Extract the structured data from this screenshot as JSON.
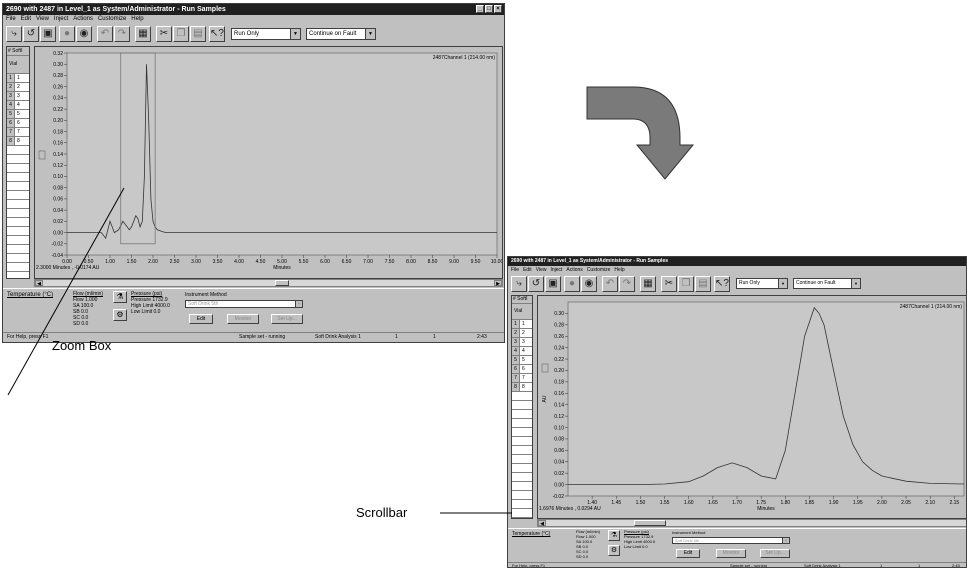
{
  "window": {
    "title": "2690 with 2487 in Level_1 as System/Administrator - Run Samples",
    "menu": [
      "File",
      "Edit",
      "View",
      "Inject",
      "Actions",
      "Customize",
      "Help"
    ],
    "run_mode": "Run Only",
    "fault_mode": "Continue on Fault",
    "grid_header": "Vial",
    "grid_corner": "#",
    "grid_col1": "SoftI",
    "grid_rows": [
      "1",
      "2",
      "3",
      "4",
      "5",
      "6",
      "7",
      "8"
    ],
    "grid_vials": [
      "1",
      "2",
      "3",
      "4",
      "5",
      "6",
      "7",
      "8"
    ],
    "temperature_label": "Temperature (°C)",
    "flow": {
      "label": "Flow (ml/min)",
      "flow": "Flow  1.000",
      "sa": "SA  100.0",
      "sb": "SB  0.0",
      "sc": "SC  0.0",
      "sd": "SD  0.0"
    },
    "pressure": {
      "label": "Pressure (psi)",
      "pressure": "Pressure  1732.9",
      "high": "High Limit 4000.0",
      "low": "Low Limit  0.0"
    },
    "method": {
      "label": "Instrument Method",
      "value": "Soft Drink 5th",
      "edit": "Edit",
      "view": "Monitor",
      "setup": "Set Up..."
    },
    "status": {
      "help": "For Help, press F1",
      "run": "Sample set - running",
      "method": "Soft Drink Analysis 1",
      "page": "1",
      "vial": "1",
      "time": "2:43"
    }
  },
  "plot1": {
    "channel": "2487Channel 1 (214.00 nm)",
    "xlabel": "Minutes",
    "ylabel": "AU",
    "cursor": "2.3000 Minutes , -0.0174 AU"
  },
  "plot2": {
    "channel": "2487Channel 1 (214.00 nm)",
    "xlabel": "Minutes",
    "ylabel": "AU",
    "cursor": "1.6976 Minutes , 0.0294 AU"
  },
  "annotations": {
    "zoom": "Zoom Box",
    "scrollbar": "Scrollbar"
  },
  "chart_data": [
    {
      "type": "line",
      "title": "2487Channel 1 (214.00 nm)",
      "xlabel": "Minutes",
      "ylabel": "AU",
      "xlim": [
        0,
        10
      ],
      "ylim": [
        -0.04,
        0.32
      ],
      "x_ticks": [
        "0.00",
        "0.50",
        "1.00",
        "1.50",
        "2.00",
        "2.50",
        "3.00",
        "3.50",
        "4.00",
        "4.50",
        "5.00",
        "5.50",
        "6.00",
        "6.50",
        "7.00",
        "7.50",
        "8.00",
        "8.50",
        "9.00",
        "9.50",
        "10.00"
      ],
      "y_ticks": [
        "-0.04",
        "-0.02",
        "0.00",
        "0.02",
        "0.04",
        "0.06",
        "0.08",
        "0.10",
        "0.12",
        "0.14",
        "0.16",
        "0.18",
        "0.20",
        "0.22",
        "0.24",
        "0.26",
        "0.28",
        "0.30",
        "0.32"
      ],
      "series": [
        {
          "x": [
            0,
            0.5,
            0.8,
            0.9,
            1.0,
            1.05,
            1.1,
            1.2,
            1.3,
            1.4,
            1.45,
            1.5,
            1.55,
            1.6,
            1.65,
            1.7,
            1.75,
            1.8,
            1.85,
            1.9,
            1.95,
            2.0,
            2.05,
            2.1,
            2.2,
            2.3,
            2.5,
            3,
            4,
            5,
            6,
            7,
            8,
            9,
            10
          ],
          "y": [
            0,
            0,
            0,
            -0.01,
            0.02,
            0.01,
            0,
            0.005,
            0.02,
            0.01,
            0.005,
            0.01,
            0.02,
            0.03,
            0.025,
            0.01,
            0.02,
            0.1,
            0.3,
            0.2,
            0.06,
            0.02,
            0.01,
            0.005,
            0.002,
            0,
            0,
            0,
            0,
            0,
            0,
            0,
            0,
            0,
            0
          ]
        }
      ]
    },
    {
      "type": "line",
      "title": "2487Channel 1 (214.00 nm)",
      "xlabel": "Minutes",
      "ylabel": "AU",
      "xlim": [
        1.35,
        2.17
      ],
      "ylim": [
        -0.02,
        0.32
      ],
      "x_ticks": [
        "1.40",
        "1.45",
        "1.50",
        "1.55",
        "1.60",
        "1.65",
        "1.70",
        "1.75",
        "1.80",
        "1.85",
        "1.90",
        "1.95",
        "2.00",
        "2.05",
        "2.10",
        "2.15"
      ],
      "y_ticks": [
        "-0.02",
        "0.00",
        "0.02",
        "0.04",
        "0.06",
        "0.08",
        "0.10",
        "0.12",
        "0.14",
        "0.16",
        "0.18",
        "0.20",
        "0.22",
        "0.24",
        "0.26",
        "0.28",
        "0.30"
      ],
      "series": [
        {
          "x": [
            1.35,
            1.4,
            1.5,
            1.55,
            1.6,
            1.63,
            1.66,
            1.69,
            1.72,
            1.75,
            1.78,
            1.8,
            1.82,
            1.84,
            1.86,
            1.87,
            1.88,
            1.9,
            1.92,
            1.94,
            1.96,
            1.98,
            2.0,
            2.05,
            2.1,
            2.17
          ],
          "y": [
            0.0,
            0.0,
            0.0,
            0.001,
            0.005,
            0.015,
            0.03,
            0.038,
            0.03,
            0.015,
            0.01,
            0.06,
            0.16,
            0.26,
            0.31,
            0.3,
            0.28,
            0.2,
            0.12,
            0.07,
            0.04,
            0.025,
            0.015,
            0.006,
            0.002,
            0.001
          ]
        }
      ]
    }
  ]
}
